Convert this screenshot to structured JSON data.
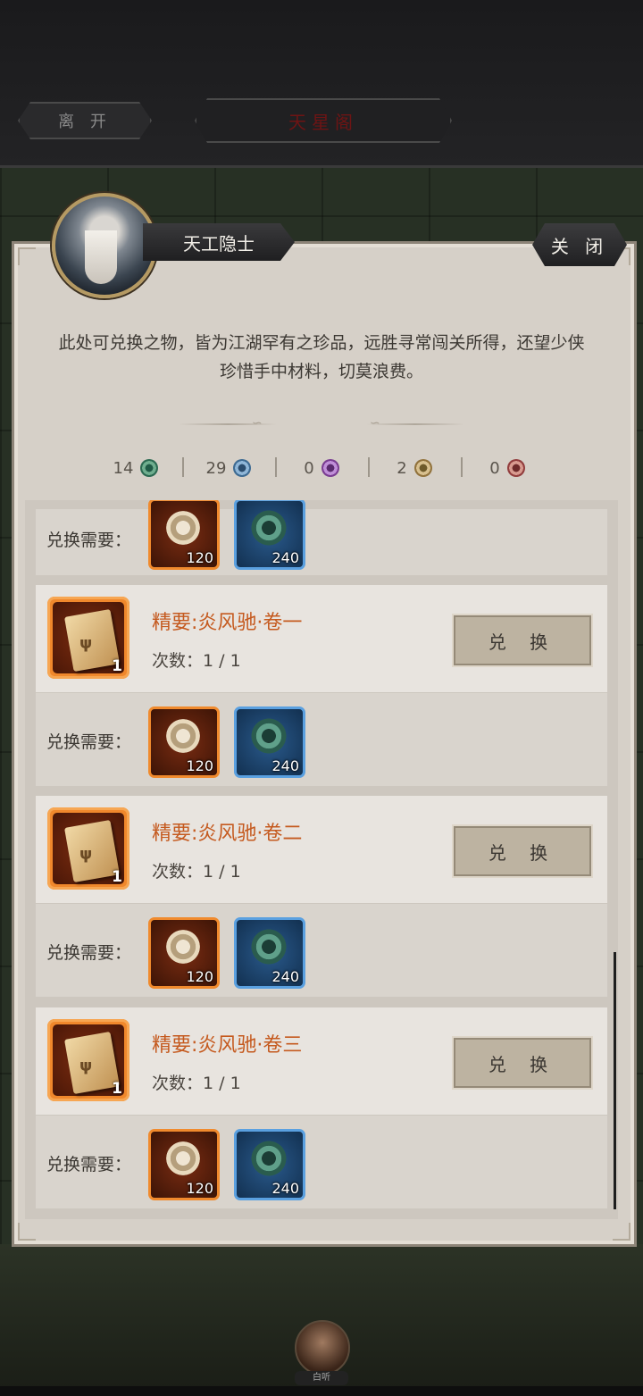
{
  "topbar": {
    "leave_label": "离 开",
    "title": "天星阁"
  },
  "panel": {
    "npc_name": "天工隐士",
    "close_label": "关 闭",
    "description": "此处可兑换之物，皆为江湖罕有之珍品，远胜寻常闯关所得，还望少侠珍惜手中材料，切莫浪费。"
  },
  "currencies": [
    {
      "count": "14",
      "icon": "green-gear-icon"
    },
    {
      "count": "29",
      "icon": "blue-gear-icon"
    },
    {
      "count": "0",
      "icon": "purple-gear-icon"
    },
    {
      "count": "2",
      "icon": "gold-gear-icon"
    },
    {
      "count": "0",
      "icon": "red-gear-icon"
    }
  ],
  "req_label": "兑换需要：",
  "exchange_label": "兑 换",
  "partial_req": {
    "sun": "120",
    "gear": "240"
  },
  "items": [
    {
      "title": "精要:炎风驰·卷一",
      "times": "次数：1 / 1",
      "count": "1",
      "sun": "120",
      "gear": "240"
    },
    {
      "title": "精要:炎风驰·卷二",
      "times": "次数：1 / 1",
      "count": "1",
      "sun": "120",
      "gear": "240"
    },
    {
      "title": "精要:炎风驰·卷三",
      "times": "次数：1 / 1",
      "count": "1",
      "sun": "120",
      "gear": "240"
    }
  ],
  "bottom": {
    "avatar_name": "白听"
  }
}
